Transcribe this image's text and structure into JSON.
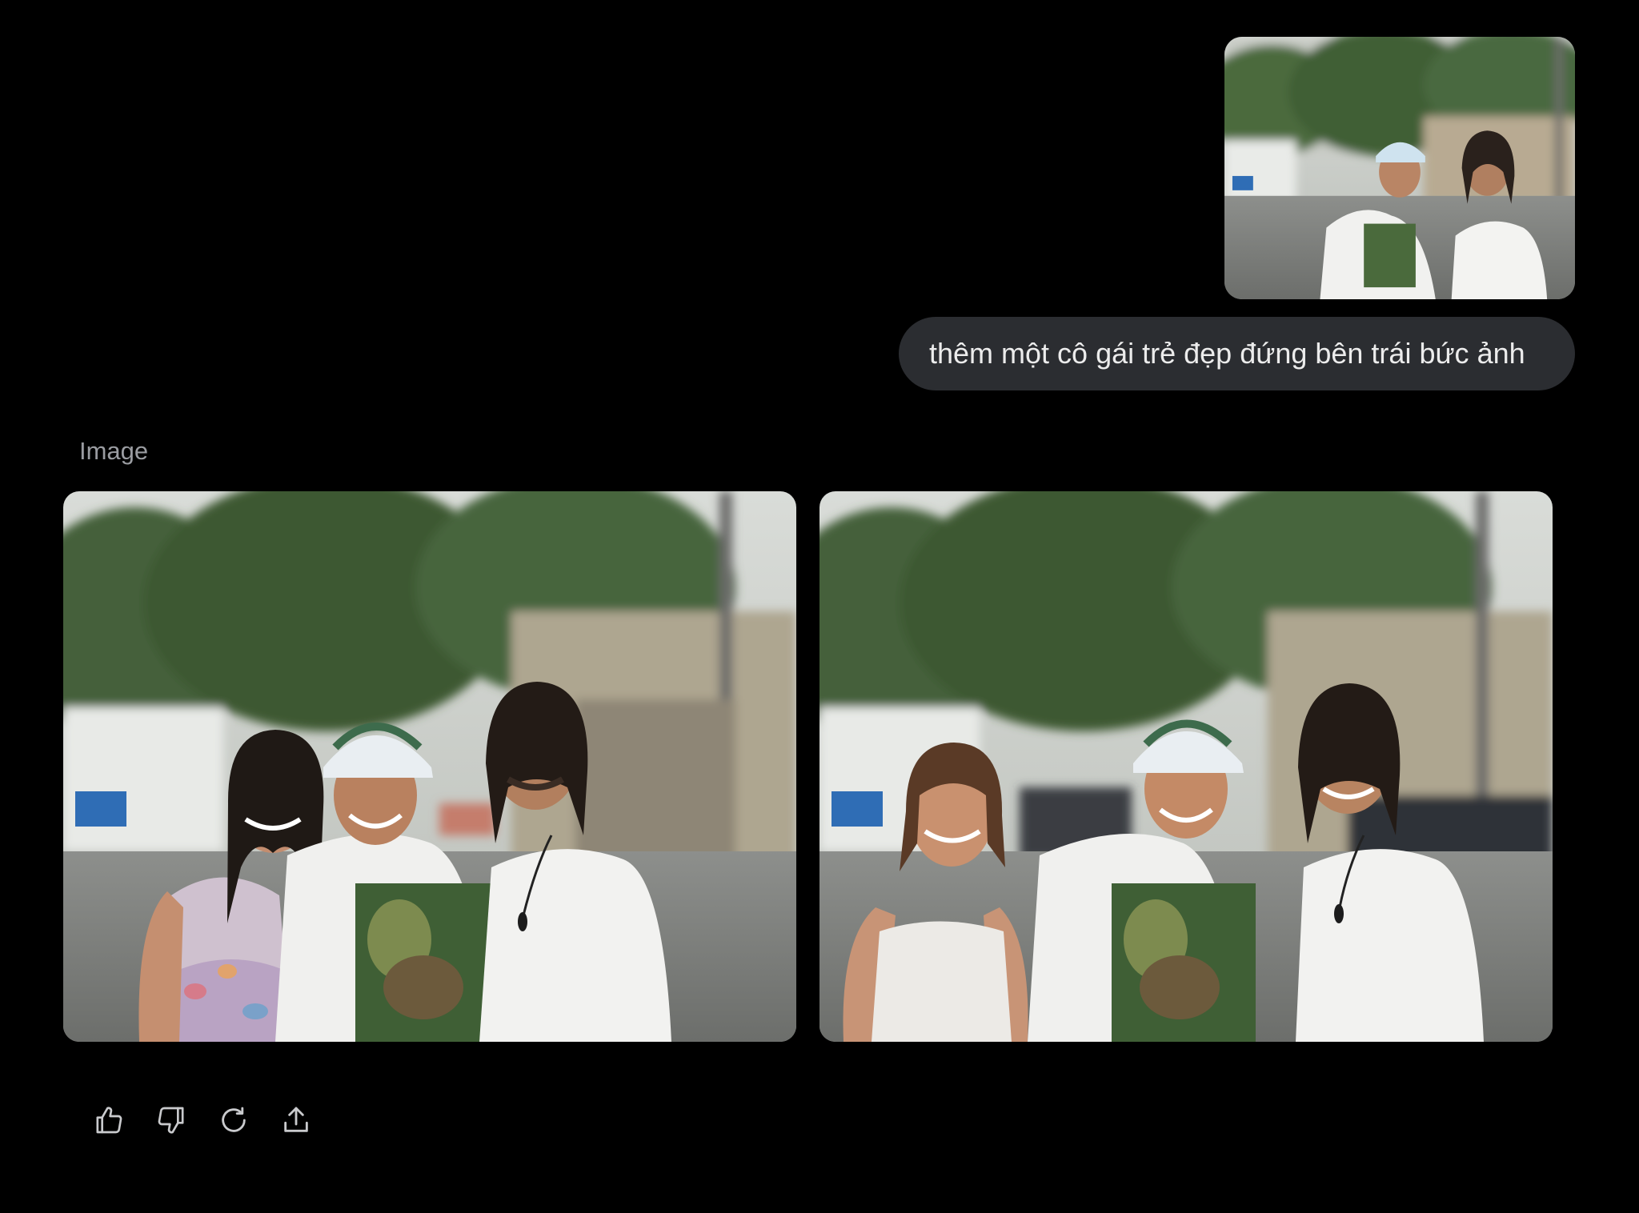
{
  "user_message": {
    "attachment_alt": "user uploaded photo of two men standing outdoors",
    "text": "thêm một cô gái trẻ đẹp đứng bên trái bức ảnh"
  },
  "assistant": {
    "label": "Image",
    "results": [
      {
        "alt": "generated image option 1"
      },
      {
        "alt": "generated image option 2"
      }
    ]
  },
  "actions": [
    {
      "name": "thumbs-up-icon"
    },
    {
      "name": "thumbs-down-icon"
    },
    {
      "name": "regenerate-icon"
    },
    {
      "name": "share-icon"
    }
  ],
  "colors": {
    "background": "#000000",
    "bubble": "#2b2d31",
    "label": "#9a9ca1",
    "icon": "#c9cacd"
  }
}
